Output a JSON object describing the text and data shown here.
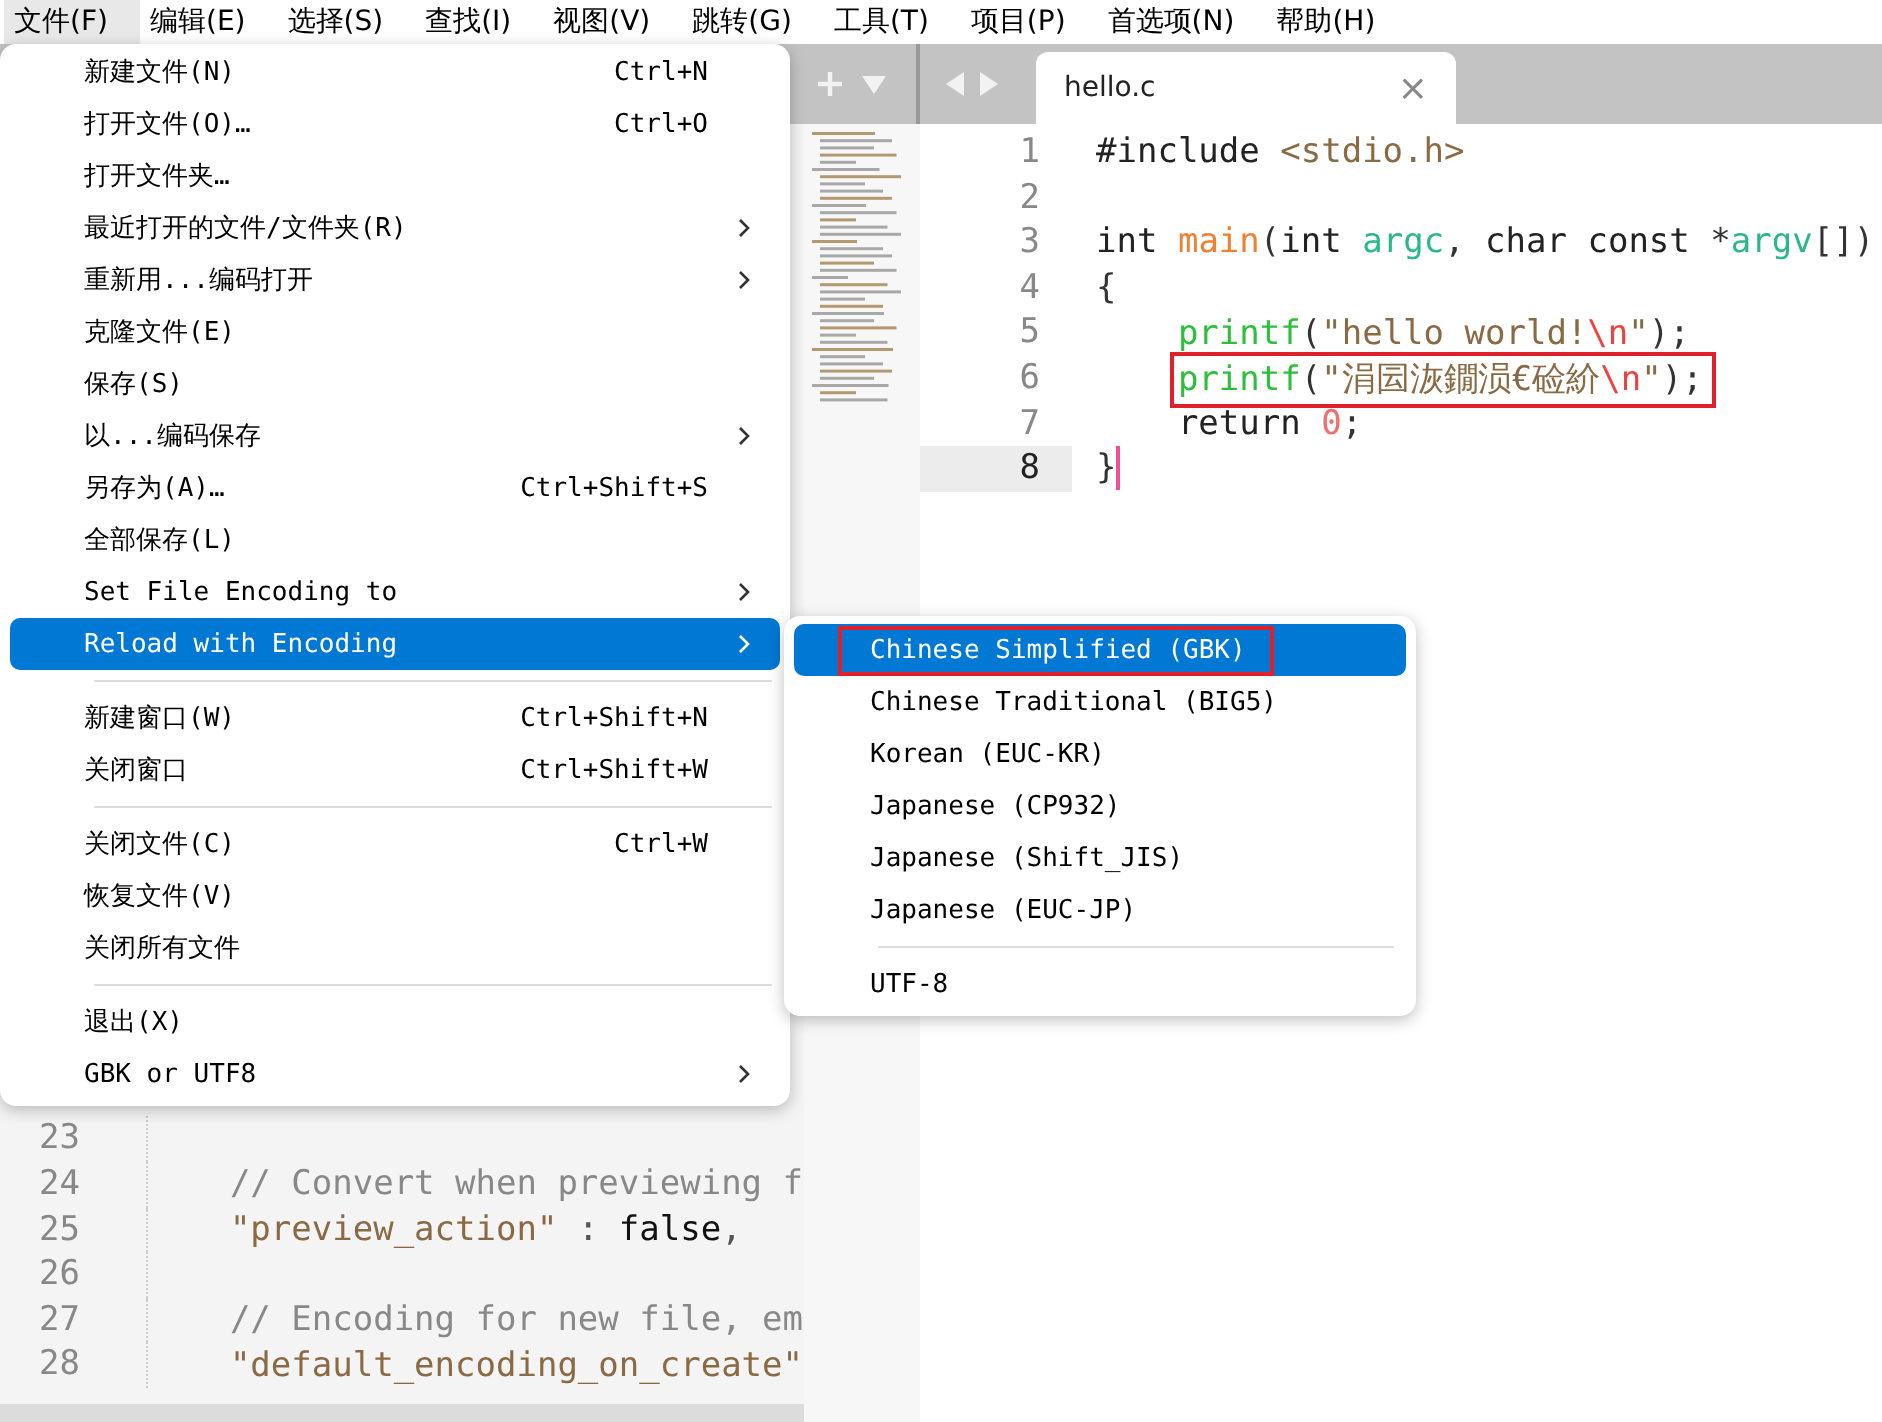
{
  "menubar": [
    {
      "label": "文件(F)",
      "selected": true
    },
    {
      "label": "编辑(E)",
      "selected": false
    },
    {
      "label": "选择(S)",
      "selected": false
    },
    {
      "label": "查找(I)",
      "selected": false
    },
    {
      "label": "视图(V)",
      "selected": false
    },
    {
      "label": "跳转(G)",
      "selected": false
    },
    {
      "label": "工具(T)",
      "selected": false
    },
    {
      "label": "项目(P)",
      "selected": false
    },
    {
      "label": "首选项(N)",
      "selected": false
    },
    {
      "label": "帮助(H)",
      "selected": false
    }
  ],
  "file_menu": [
    {
      "kind": "item",
      "label": "新建文件(N)",
      "shortcut": "Ctrl+N",
      "submenu": false,
      "selected": false
    },
    {
      "kind": "item",
      "label": "打开文件(O)…",
      "shortcut": "Ctrl+O",
      "submenu": false,
      "selected": false
    },
    {
      "kind": "item",
      "label": "打开文件夹…",
      "submenu": false,
      "selected": false
    },
    {
      "kind": "item",
      "label": "最近打开的文件/文件夹(R)",
      "submenu": true,
      "selected": false
    },
    {
      "kind": "item",
      "label": "重新用...编码打开",
      "submenu": true,
      "selected": false
    },
    {
      "kind": "item",
      "label": "克隆文件(E)",
      "submenu": false,
      "selected": false
    },
    {
      "kind": "item",
      "label": "保存(S)",
      "submenu": false,
      "selected": false
    },
    {
      "kind": "item",
      "label": "以...编码保存",
      "submenu": true,
      "selected": false
    },
    {
      "kind": "item",
      "label": "另存为(A)…",
      "shortcut": "Ctrl+Shift+S",
      "submenu": false,
      "selected": false
    },
    {
      "kind": "item",
      "label": "全部保存(L)",
      "submenu": false,
      "selected": false
    },
    {
      "kind": "item",
      "label": "Set File Encoding to",
      "submenu": true,
      "selected": false
    },
    {
      "kind": "item",
      "label": "Reload with Encoding",
      "submenu": true,
      "selected": true
    },
    {
      "kind": "separator"
    },
    {
      "kind": "item",
      "label": "新建窗口(W)",
      "shortcut": "Ctrl+Shift+N",
      "submenu": false,
      "selected": false
    },
    {
      "kind": "item",
      "label": "关闭窗口",
      "shortcut": "Ctrl+Shift+W",
      "submenu": false,
      "selected": false
    },
    {
      "kind": "separator"
    },
    {
      "kind": "item",
      "label": "关闭文件(C)",
      "shortcut": "Ctrl+W",
      "submenu": false,
      "selected": false
    },
    {
      "kind": "item",
      "label": "恢复文件(V)",
      "submenu": false,
      "selected": false
    },
    {
      "kind": "item",
      "label": "关闭所有文件",
      "submenu": false,
      "selected": false
    },
    {
      "kind": "separator"
    },
    {
      "kind": "item",
      "label": "退出(X)",
      "submenu": false,
      "selected": false
    },
    {
      "kind": "item",
      "label": "GBK or UTF8",
      "submenu": true,
      "selected": false
    }
  ],
  "encoding_submenu": [
    {
      "kind": "item",
      "label": "Chinese Simplified (GBK)",
      "selected": true,
      "highlighted": true
    },
    {
      "kind": "item",
      "label": "Chinese Traditional (BIG5)",
      "selected": false,
      "highlighted": false
    },
    {
      "kind": "item",
      "label": "Korean (EUC-KR)",
      "selected": false,
      "highlighted": false
    },
    {
      "kind": "item",
      "label": "Japanese (CP932)",
      "selected": false,
      "highlighted": false
    },
    {
      "kind": "item",
      "label": "Japanese (Shift_JIS)",
      "selected": false,
      "highlighted": false
    },
    {
      "kind": "item",
      "label": "Japanese (EUC-JP)",
      "selected": false,
      "highlighted": false
    },
    {
      "kind": "separator"
    },
    {
      "kind": "item",
      "label": "UTF-8",
      "selected": false,
      "highlighted": false
    }
  ],
  "left_pane": {
    "lines": [
      {
        "number": "23"
      },
      {
        "number": "24",
        "segments": [
          {
            "kind": "comment",
            "text": "    // Convert when previewing f"
          }
        ]
      },
      {
        "number": "25",
        "segments": [
          {
            "kind": "string",
            "text": "    \"preview_action\""
          },
          {
            "kind": "plain",
            "text": " : "
          },
          {
            "kind": "keyword",
            "text": "false"
          },
          {
            "kind": "plain",
            "text": ","
          }
        ]
      },
      {
        "number": "26"
      },
      {
        "number": "27",
        "segments": [
          {
            "kind": "comment",
            "text": "    // Encoding for new file, em"
          }
        ]
      },
      {
        "number": "28",
        "segments": [
          {
            "kind": "string",
            "text": "    \"default_encoding_on_create\""
          }
        ]
      }
    ]
  },
  "tabs": [
    {
      "label": "hello.c",
      "selected": true,
      "close": "×"
    }
  ],
  "editor": {
    "lines": [
      {
        "number": "1",
        "segments": [
          {
            "kind": "keyword",
            "text": "#include "
          },
          {
            "kind": "string",
            "text": "<stdio.h>"
          }
        ]
      },
      {
        "number": "2"
      },
      {
        "number": "3",
        "segments": [
          {
            "kind": "keyword",
            "text": "int "
          },
          {
            "kind": "function",
            "text": "main"
          },
          {
            "kind": "plain",
            "text": "("
          },
          {
            "kind": "keyword",
            "text": "int "
          },
          {
            "kind": "param",
            "text": "argc"
          },
          {
            "kind": "plain",
            "text": ", "
          },
          {
            "kind": "keyword",
            "text": "char const "
          },
          {
            "kind": "plain",
            "text": "*"
          },
          {
            "kind": "param",
            "text": "argv"
          },
          {
            "kind": "plain",
            "text": "[])"
          }
        ]
      },
      {
        "number": "4",
        "segments": [
          {
            "kind": "plain",
            "text": "{"
          }
        ]
      },
      {
        "number": "5",
        "segments": [
          {
            "kind": "call",
            "text": "    printf"
          },
          {
            "kind": "plain",
            "text": "("
          },
          {
            "kind": "string",
            "text": "\"hello world!"
          },
          {
            "kind": "escape",
            "text": "\\n"
          },
          {
            "kind": "string",
            "text": "\""
          },
          {
            "kind": "plain",
            "text": ");"
          }
        ]
      },
      {
        "number": "6",
        "annotated": true,
        "segments": [
          {
            "kind": "call",
            "text": "    printf"
          },
          {
            "kind": "plain",
            "text": "("
          },
          {
            "kind": "string",
            "text": "\"涓囩洃鐗涢€硷紒"
          },
          {
            "kind": "escape",
            "text": "\\n"
          },
          {
            "kind": "string",
            "text": "\""
          },
          {
            "kind": "plain",
            "text": ");"
          }
        ]
      },
      {
        "number": "7",
        "segments": [
          {
            "kind": "keyword",
            "text": "    return "
          },
          {
            "kind": "number",
            "text": "0"
          },
          {
            "kind": "plain",
            "text": ";"
          }
        ]
      },
      {
        "number": "8",
        "current": true,
        "segments": [
          {
            "kind": "plain",
            "text": "}"
          }
        ]
      }
    ]
  }
}
